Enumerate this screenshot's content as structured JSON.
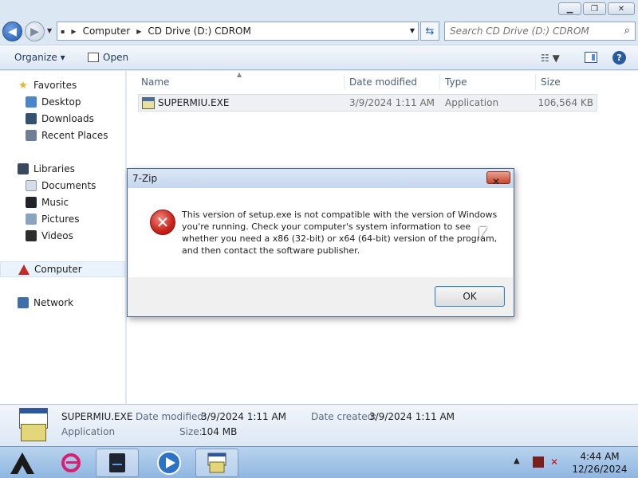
{
  "address": {
    "segments": [
      "Computer",
      "CD Drive (D:) CDROM"
    ],
    "search_placeholder": "Search CD Drive (D:) CDROM"
  },
  "toolbar": {
    "organize": "Organize ▾",
    "open": "Open"
  },
  "nav": {
    "favorites": "Favorites",
    "desktop": "Desktop",
    "downloads": "Downloads",
    "recent": "Recent Places",
    "libraries": "Libraries",
    "documents": "Documents",
    "music": "Music",
    "pictures": "Pictures",
    "videos": "Videos",
    "computer": "Computer",
    "network": "Network"
  },
  "columns": {
    "name": "Name",
    "date": "Date modified",
    "type": "Type",
    "size": "Size"
  },
  "file": {
    "name": "SUPERMIU.EXE",
    "date": "3/9/2024 1:11 AM",
    "type": "Application",
    "size": "106,564 KB"
  },
  "details": {
    "name": "SUPERMIU.EXE",
    "type": "Application",
    "date_modified_label": "Date modified:",
    "date_modified": "3/9/2024 1:11 AM",
    "date_created_label": "Date created:",
    "date_created": "3/9/2024 1:11 AM",
    "size_label": "Size:",
    "size": "104 MB"
  },
  "dialog": {
    "title": "7-Zip",
    "message": "This version of setup.exe is not compatible with the version of Windows you're running. Check your computer's system information to see whether you need a x86 (32-bit) or x64 (64-bit) version of the program, and then contact the software publisher.",
    "ok": "OK"
  },
  "clock": {
    "time": "4:44 AM",
    "date": "12/26/2024"
  },
  "icons": {
    "back": "back-arrow-icon",
    "forward": "forward-arrow-icon",
    "refresh": "refresh-icon",
    "search": "magnifier-icon",
    "error": "error-x-icon"
  },
  "colors": {
    "accent": "#2a5aa0",
    "error": "#c8211a",
    "taskbar": "#a7c6e8"
  }
}
